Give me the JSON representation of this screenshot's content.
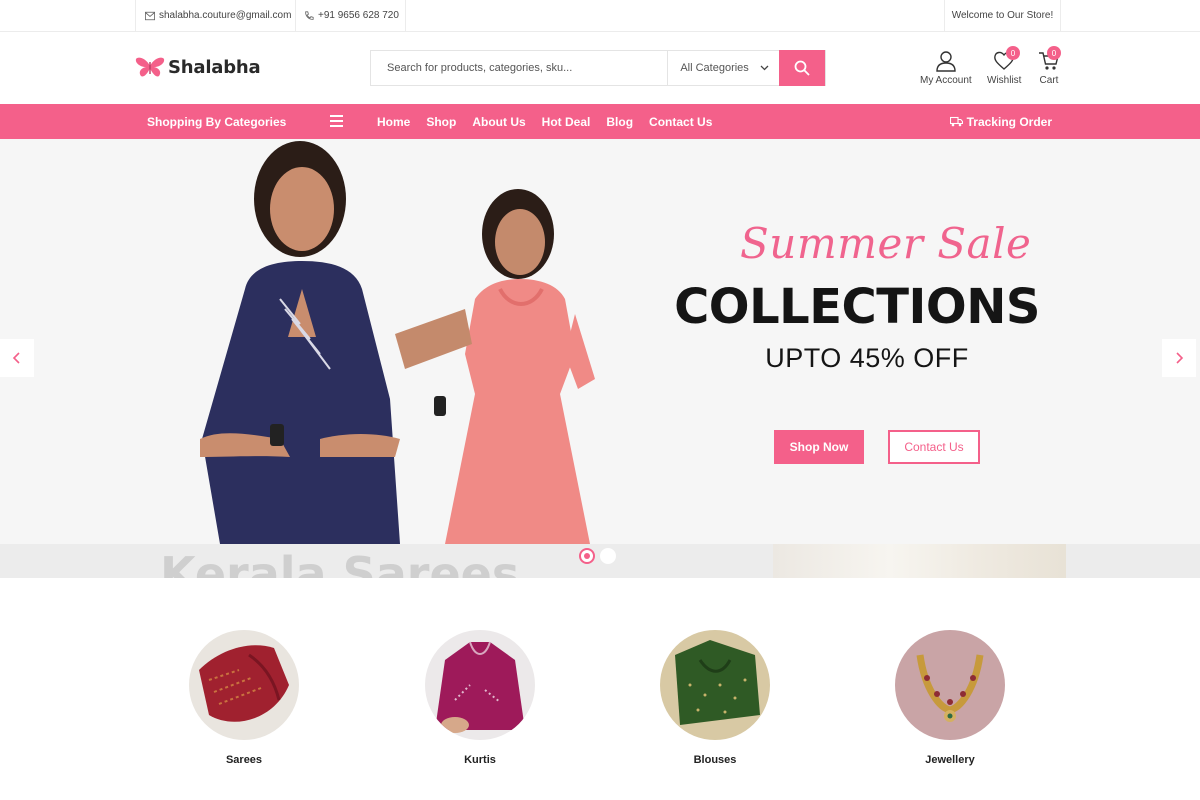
{
  "topbar": {
    "email": "shalabha.couture@gmail.com",
    "phone": "+91 9656 628 720",
    "welcome": "Welcome to Our Store!"
  },
  "header": {
    "brand": "Shalabha",
    "search_placeholder": "Search for products, categories, sku...",
    "category_select": "All Categories",
    "account_label": "My Account",
    "wishlist_label": "Wishlist",
    "wishlist_count": "0",
    "cart_label": "Cart",
    "cart_count": "0"
  },
  "nav": {
    "categories_label": "Shopping By Categories",
    "links": [
      "Home",
      "Shop",
      "About Us",
      "Hot Deal",
      "Blog",
      "Contact Us"
    ],
    "tracking_label": "Tracking Order"
  },
  "hero": {
    "script_title": "Summer Sale",
    "headline": "COLLECTIONS",
    "subline": "UPTO 45% OFF",
    "primary_button": "Shop Now",
    "secondary_button": "Contact Us",
    "next_slide_peek": "Kerala Sarees",
    "active_slide": 1,
    "slide_count": 2
  },
  "categories": [
    {
      "name": "Sarees",
      "color": "#a0212f"
    },
    {
      "name": "Kurtis",
      "color": "#9e1a5a"
    },
    {
      "name": "Blouses",
      "color": "#2f5a25"
    },
    {
      "name": "Jewellery",
      "color": "#c9a4a6"
    }
  ],
  "colors": {
    "accent": "#f4608a",
    "text_dark": "#151515"
  }
}
